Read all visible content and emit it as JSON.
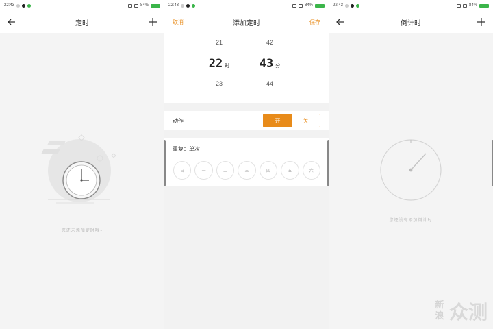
{
  "statusbar": {
    "time": "22:43",
    "battery": "84%"
  },
  "screen1": {
    "title": "定时",
    "empty_text": "您还未添加定时哦~",
    "icons": {
      "back": "arrow-left-icon",
      "add": "plus-icon",
      "art": "clock-illustration"
    }
  },
  "screen2": {
    "title": "添加定时",
    "cancel_label": "取消",
    "save_label": "保存",
    "picker": {
      "hours": {
        "prev": "21",
        "current": "22",
        "next": "23",
        "unit": "时"
      },
      "minutes": {
        "prev": "42",
        "current": "43",
        "next": "44",
        "unit": "分"
      }
    },
    "action": {
      "label": "动作",
      "on_label": "开",
      "off_label": "关",
      "selected": "on"
    },
    "repeat": {
      "label": "重复：单次",
      "days": [
        "日",
        "一",
        "二",
        "三",
        "四",
        "五",
        "六"
      ]
    },
    "colors": {
      "accent": "#e88b1a"
    }
  },
  "screen3": {
    "title": "倒计时",
    "empty_text": "您还没有添加倒计时",
    "icons": {
      "back": "arrow-left-icon",
      "add": "plus-icon",
      "dial": "countdown-dial-icon"
    }
  },
  "watermark": {
    "brand_box": "新浪",
    "brand_text": "众测"
  }
}
